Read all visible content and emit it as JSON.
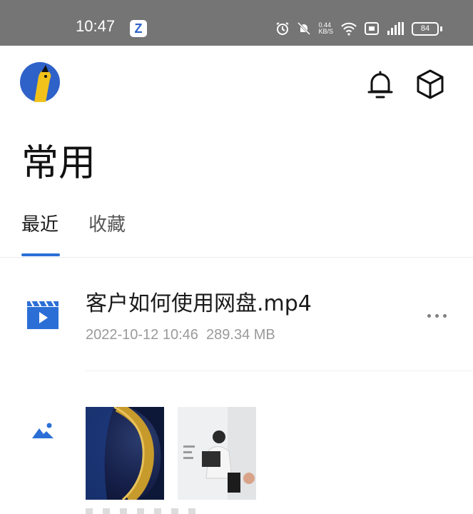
{
  "status_bar": {
    "time": "10:47",
    "app_badge": "Z",
    "net_speed_value": "0.44",
    "net_speed_unit": "KB/S",
    "battery": "84"
  },
  "header": {
    "icons": [
      "avatar",
      "bell-icon",
      "cube-icon"
    ]
  },
  "page": {
    "title": "常用"
  },
  "tabs": [
    {
      "label": "最近",
      "active": true
    },
    {
      "label": "收藏",
      "active": false
    }
  ],
  "recent": {
    "files": [
      {
        "name": "客户如何使用网盘.mp4",
        "date": "2022-10-12 10:46",
        "size": "289.34 MB",
        "icon": "video-file-icon"
      }
    ],
    "images_group": {
      "icon": "image-icon",
      "thumbnail_count": 2
    }
  },
  "colors": {
    "accent": "#2b6fd6",
    "status_bar": "#757575",
    "meta_text": "#9a9a9a"
  }
}
